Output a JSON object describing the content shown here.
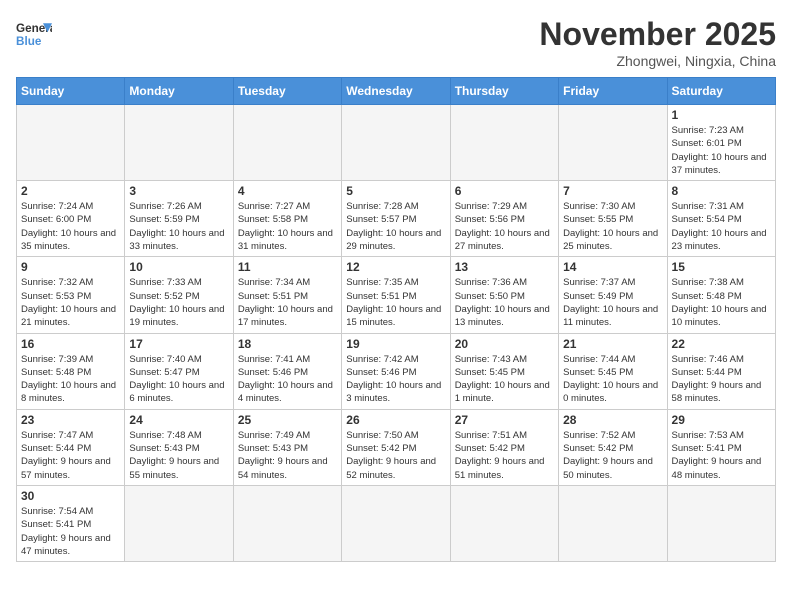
{
  "header": {
    "logo_general": "General",
    "logo_blue": "Blue",
    "month": "November 2025",
    "location": "Zhongwei, Ningxia, China"
  },
  "days_of_week": [
    "Sunday",
    "Monday",
    "Tuesday",
    "Wednesday",
    "Thursday",
    "Friday",
    "Saturday"
  ],
  "weeks": [
    [
      {
        "day": "",
        "info": ""
      },
      {
        "day": "",
        "info": ""
      },
      {
        "day": "",
        "info": ""
      },
      {
        "day": "",
        "info": ""
      },
      {
        "day": "",
        "info": ""
      },
      {
        "day": "",
        "info": ""
      },
      {
        "day": "1",
        "info": "Sunrise: 7:23 AM\nSunset: 6:01 PM\nDaylight: 10 hours and 37 minutes."
      }
    ],
    [
      {
        "day": "2",
        "info": "Sunrise: 7:24 AM\nSunset: 6:00 PM\nDaylight: 10 hours and 35 minutes."
      },
      {
        "day": "3",
        "info": "Sunrise: 7:26 AM\nSunset: 5:59 PM\nDaylight: 10 hours and 33 minutes."
      },
      {
        "day": "4",
        "info": "Sunrise: 7:27 AM\nSunset: 5:58 PM\nDaylight: 10 hours and 31 minutes."
      },
      {
        "day": "5",
        "info": "Sunrise: 7:28 AM\nSunset: 5:57 PM\nDaylight: 10 hours and 29 minutes."
      },
      {
        "day": "6",
        "info": "Sunrise: 7:29 AM\nSunset: 5:56 PM\nDaylight: 10 hours and 27 minutes."
      },
      {
        "day": "7",
        "info": "Sunrise: 7:30 AM\nSunset: 5:55 PM\nDaylight: 10 hours and 25 minutes."
      },
      {
        "day": "8",
        "info": "Sunrise: 7:31 AM\nSunset: 5:54 PM\nDaylight: 10 hours and 23 minutes."
      }
    ],
    [
      {
        "day": "9",
        "info": "Sunrise: 7:32 AM\nSunset: 5:53 PM\nDaylight: 10 hours and 21 minutes."
      },
      {
        "day": "10",
        "info": "Sunrise: 7:33 AM\nSunset: 5:52 PM\nDaylight: 10 hours and 19 minutes."
      },
      {
        "day": "11",
        "info": "Sunrise: 7:34 AM\nSunset: 5:51 PM\nDaylight: 10 hours and 17 minutes."
      },
      {
        "day": "12",
        "info": "Sunrise: 7:35 AM\nSunset: 5:51 PM\nDaylight: 10 hours and 15 minutes."
      },
      {
        "day": "13",
        "info": "Sunrise: 7:36 AM\nSunset: 5:50 PM\nDaylight: 10 hours and 13 minutes."
      },
      {
        "day": "14",
        "info": "Sunrise: 7:37 AM\nSunset: 5:49 PM\nDaylight: 10 hours and 11 minutes."
      },
      {
        "day": "15",
        "info": "Sunrise: 7:38 AM\nSunset: 5:48 PM\nDaylight: 10 hours and 10 minutes."
      }
    ],
    [
      {
        "day": "16",
        "info": "Sunrise: 7:39 AM\nSunset: 5:48 PM\nDaylight: 10 hours and 8 minutes."
      },
      {
        "day": "17",
        "info": "Sunrise: 7:40 AM\nSunset: 5:47 PM\nDaylight: 10 hours and 6 minutes."
      },
      {
        "day": "18",
        "info": "Sunrise: 7:41 AM\nSunset: 5:46 PM\nDaylight: 10 hours and 4 minutes."
      },
      {
        "day": "19",
        "info": "Sunrise: 7:42 AM\nSunset: 5:46 PM\nDaylight: 10 hours and 3 minutes."
      },
      {
        "day": "20",
        "info": "Sunrise: 7:43 AM\nSunset: 5:45 PM\nDaylight: 10 hours and 1 minute."
      },
      {
        "day": "21",
        "info": "Sunrise: 7:44 AM\nSunset: 5:45 PM\nDaylight: 10 hours and 0 minutes."
      },
      {
        "day": "22",
        "info": "Sunrise: 7:46 AM\nSunset: 5:44 PM\nDaylight: 9 hours and 58 minutes."
      }
    ],
    [
      {
        "day": "23",
        "info": "Sunrise: 7:47 AM\nSunset: 5:44 PM\nDaylight: 9 hours and 57 minutes."
      },
      {
        "day": "24",
        "info": "Sunrise: 7:48 AM\nSunset: 5:43 PM\nDaylight: 9 hours and 55 minutes."
      },
      {
        "day": "25",
        "info": "Sunrise: 7:49 AM\nSunset: 5:43 PM\nDaylight: 9 hours and 54 minutes."
      },
      {
        "day": "26",
        "info": "Sunrise: 7:50 AM\nSunset: 5:42 PM\nDaylight: 9 hours and 52 minutes."
      },
      {
        "day": "27",
        "info": "Sunrise: 7:51 AM\nSunset: 5:42 PM\nDaylight: 9 hours and 51 minutes."
      },
      {
        "day": "28",
        "info": "Sunrise: 7:52 AM\nSunset: 5:42 PM\nDaylight: 9 hours and 50 minutes."
      },
      {
        "day": "29",
        "info": "Sunrise: 7:53 AM\nSunset: 5:41 PM\nDaylight: 9 hours and 48 minutes."
      }
    ],
    [
      {
        "day": "30",
        "info": "Sunrise: 7:54 AM\nSunset: 5:41 PM\nDaylight: 9 hours and 47 minutes."
      },
      {
        "day": "",
        "info": ""
      },
      {
        "day": "",
        "info": ""
      },
      {
        "day": "",
        "info": ""
      },
      {
        "day": "",
        "info": ""
      },
      {
        "day": "",
        "info": ""
      },
      {
        "day": "",
        "info": ""
      }
    ]
  ]
}
